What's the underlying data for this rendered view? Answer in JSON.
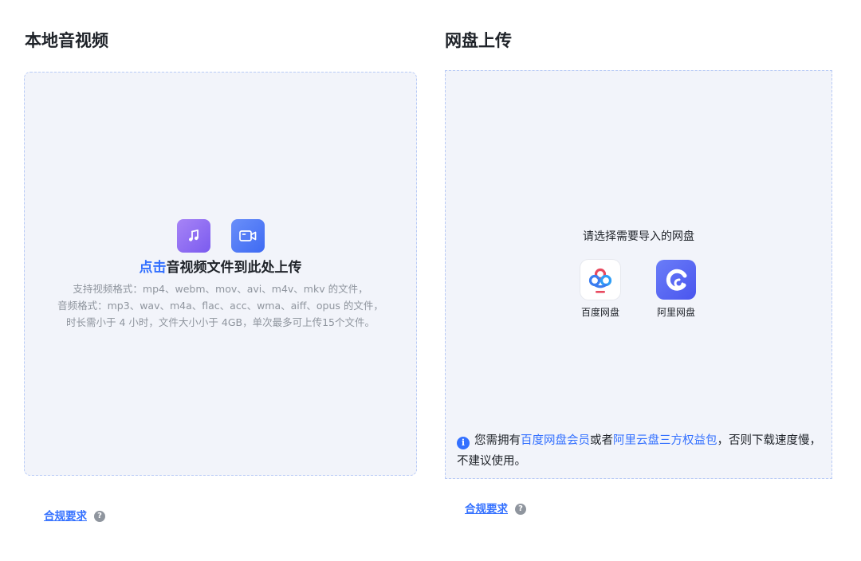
{
  "local": {
    "title": "本地音视频",
    "upload_link": "点击",
    "upload_text": "音视频文件到此处上传",
    "hint_lines": [
      "支持视频格式：mp4、webm、mov、avi、m4v、mkv 的文件，",
      "音频格式：mp3、wav、m4a、flac、acc、wma、aiff、opus 的文件，",
      "时长需小于 4 小时，文件大小小于 4GB，单次最多可上传15个文件。"
    ],
    "icons": [
      "music-note-icon",
      "video-camera-icon"
    ],
    "compliance_label": "合规要求",
    "help_glyph": "?"
  },
  "cloud": {
    "title": "网盘上传",
    "prompt": "请选择需要导入的网盘",
    "drives": [
      {
        "label": "百度网盘",
        "icon": "baidu-netdisk-icon"
      },
      {
        "label": "阿里网盘",
        "icon": "aliyun-drive-icon"
      }
    ],
    "notice": {
      "icon_glyph": "i",
      "prefix": "您需拥有",
      "link1": "百度网盘会员",
      "middle": "或者",
      "link2": "阿里云盘三方权益包",
      "suffix": "，否则下载速度慢，不建议使用。"
    },
    "compliance_label": "合规要求",
    "help_glyph": "?"
  },
  "colors": {
    "accent": "#3370ff",
    "panel_bg": "#f2f4fa",
    "panel_border": "#b9cbf6",
    "muted_text": "#8f959e"
  }
}
